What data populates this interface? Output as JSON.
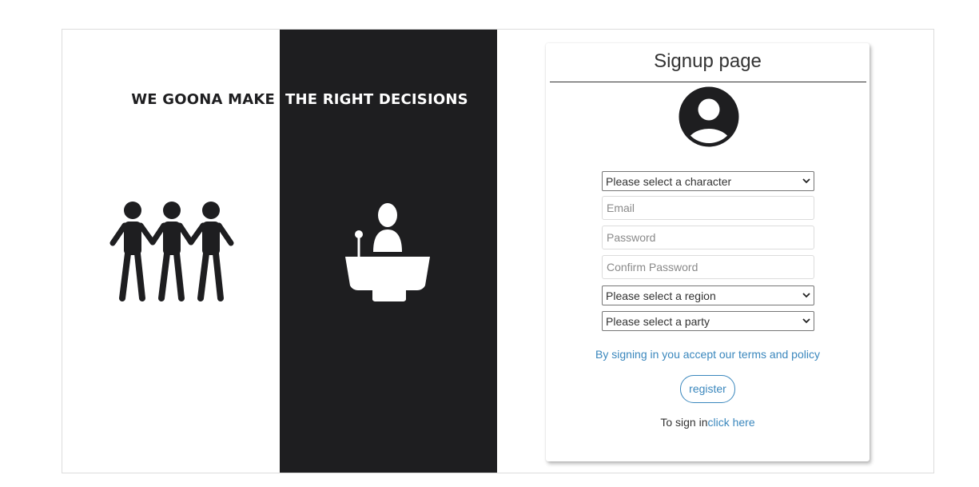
{
  "hero": {
    "slogan_left": "WE GOONA MAKE",
    "slogan_right": "THE RIGHT DECISIONS",
    "illustrations": [
      "three-people-holding-hands-icon",
      "speaker-at-podium-icon"
    ]
  },
  "signup": {
    "title": "Signup page",
    "avatar_icon": "user-avatar-icon",
    "character_select": "Please select a character",
    "email_placeholder": "Email",
    "password_placeholder": "Password",
    "confirm_password_placeholder": "Confirm Password",
    "region_select": "Please select a region",
    "party_select": "Please select a party",
    "terms_text": "By signing in you accept our terms and policy",
    "register_label": "register",
    "signin_prefix": "To sign in",
    "signin_link": "click here"
  },
  "colors": {
    "dark_panel": "#1e1e20",
    "link_accent": "#3a87bd",
    "text": "#333333"
  }
}
